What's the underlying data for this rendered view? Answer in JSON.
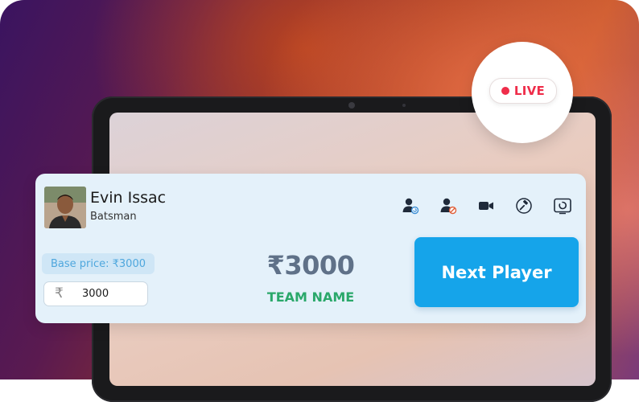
{
  "live_badge": {
    "label": "LIVE",
    "color": "#ef2d4a"
  },
  "player": {
    "name": "Evin Issac",
    "role": "Batsman"
  },
  "action_icons": [
    "user-refresh-icon",
    "user-block-icon",
    "video-camera-icon",
    "auction-hammer-icon",
    "screen-timer-icon"
  ],
  "bid": {
    "base_price": "Base price: ₹3000",
    "currency_symbol": "₹",
    "input_value": "3000"
  },
  "current_bid": {
    "price": "₹3000",
    "team": "TEAM NAME"
  },
  "next_button": {
    "label": "Next Player",
    "color": "#15a4ea"
  }
}
